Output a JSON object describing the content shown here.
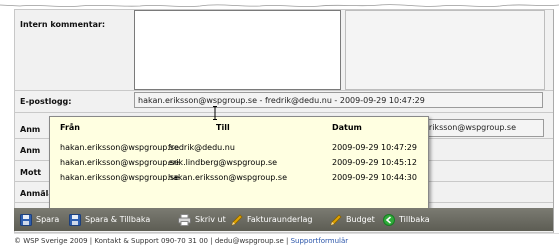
{
  "form": {
    "intern_label": "Intern kommentar:",
    "epost_label": "E-postlogg:",
    "epost_value": "hakan.eriksson@wspgroup.se - fredrik@dedu.nu - 2009-09-29 10:47:29",
    "anm1_label": "Anm",
    "anm2_label": "Anm",
    "mott_label": "Mott",
    "side_value": "eriksson@wspgroup.se",
    "anmalare_label": "Anmälare kontaktad:",
    "anmalare_checked": "✓"
  },
  "tooltip": {
    "headers": {
      "from": "Från",
      "to": "Till",
      "date": "Datum"
    },
    "rows": [
      {
        "from": "hakan.eriksson@wspgroup.se",
        "to": "fredrik@dedu.nu",
        "date": "2009-09-29 10:47:29"
      },
      {
        "from": "hakan.eriksson@wspgroup.se",
        "to": "erik.lindberg@wspgroup.se",
        "date": "2009-09-29 10:45:12"
      },
      {
        "from": "hakan.eriksson@wspgroup.se",
        "to": "hakan.eriksson@wspgroup.se",
        "date": "2009-09-29 10:44:30"
      }
    ]
  },
  "toolbar": {
    "spara": "Spara",
    "spara_tillbaka": "Spara & Tillbaka",
    "skriv_ut": "Skriv ut",
    "fakturaunderlag": "Fakturaunderlag",
    "budget": "Budget",
    "tillbaka": "Tillbaka"
  },
  "footer": {
    "text": "© WSP Sverige 2009 | Kontakt & Support 090-70 31 00 | dedu@wspgroup.se | ",
    "link": "Supportformulär"
  },
  "colors": {
    "toolbar": "#6b6b62",
    "tooltip_bg": "#ffffe1",
    "save_icon": "#2f5fb0",
    "pencil_icon": "#e0a400",
    "back_icon": "#2eab39"
  }
}
